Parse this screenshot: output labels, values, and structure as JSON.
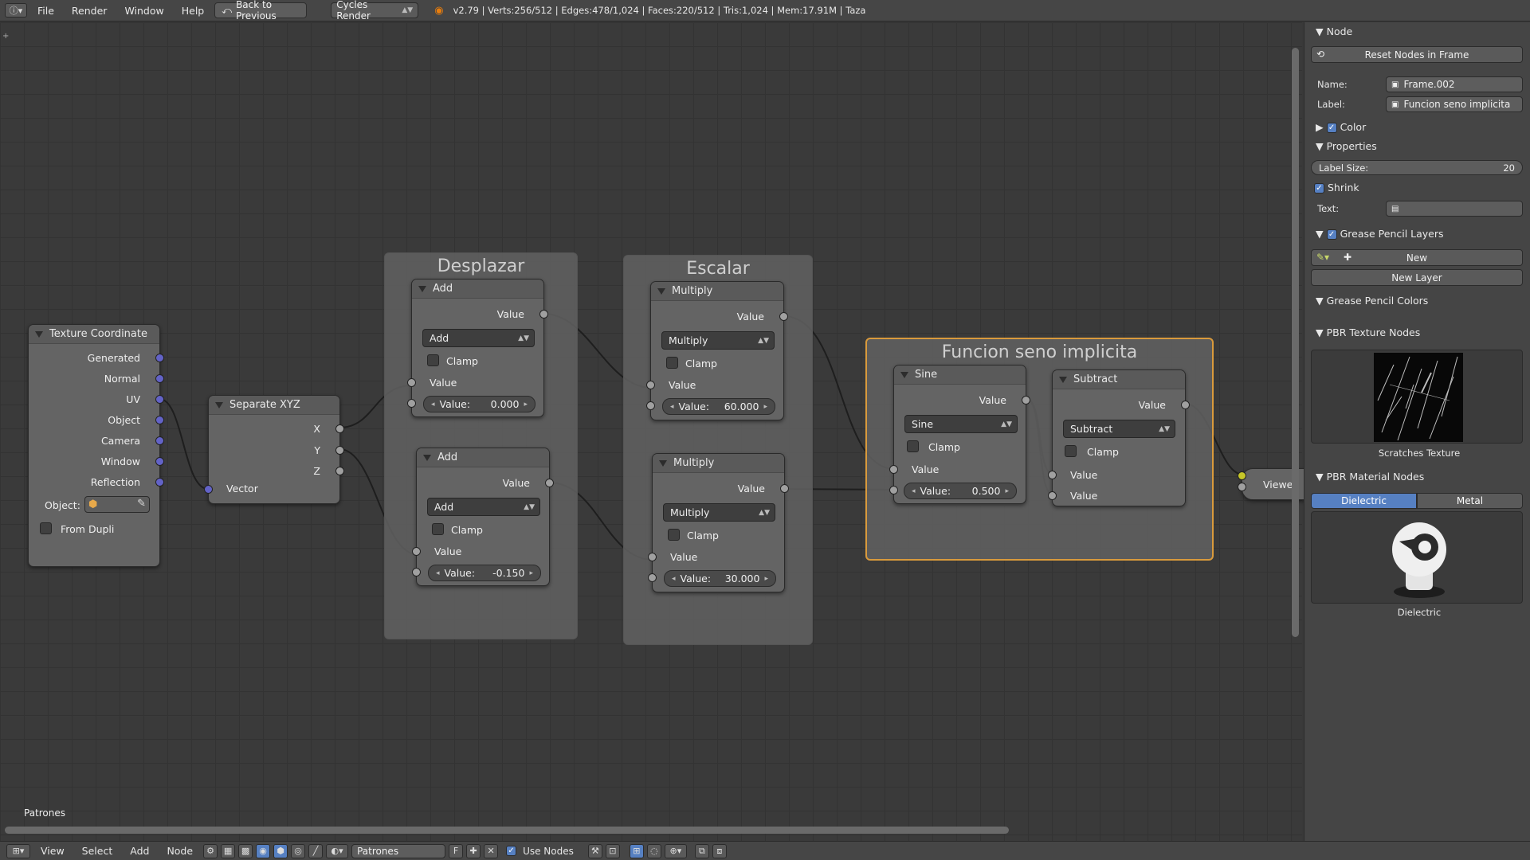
{
  "topbar": {
    "info_icon": "info-icon",
    "menus": [
      "File",
      "Render",
      "Window",
      "Help"
    ],
    "back_button": "Back to Previous",
    "engine": "Cycles Render",
    "stats": "v2.79 | Verts:256/512 | Edges:478/1,024 | Faces:220/512 | Tris:1,024 | Mem:17.91M | Taza"
  },
  "editor": {
    "scene_label": "Patrones",
    "frames": {
      "desplazar": "Desplazar",
      "escalar": "Escalar",
      "funcion": "Funcion seno implicita"
    },
    "tex_coord": {
      "title": "Texture Coordinate",
      "outputs": [
        "Generated",
        "Normal",
        "UV",
        "Object",
        "Camera",
        "Window",
        "Reflection"
      ],
      "object_label": "Object:",
      "from_dupli": "From Dupli"
    },
    "separate": {
      "title": "Separate XYZ",
      "outputs": [
        "X",
        "Y",
        "Z"
      ],
      "input": "Vector"
    },
    "add1": {
      "title": "Add",
      "out": "Value",
      "op": "Add",
      "clamp": "Clamp",
      "in": "Value",
      "field_label": "Value:",
      "field_value": "0.000"
    },
    "add2": {
      "title": "Add",
      "out": "Value",
      "op": "Add",
      "clamp": "Clamp",
      "in": "Value",
      "field_label": "Value:",
      "field_value": "-0.150"
    },
    "mul1": {
      "title": "Multiply",
      "out": "Value",
      "op": "Multiply",
      "clamp": "Clamp",
      "in": "Value",
      "field_label": "Value:",
      "field_value": "60.000"
    },
    "mul2": {
      "title": "Multiply",
      "out": "Value",
      "op": "Multiply",
      "clamp": "Clamp",
      "in": "Value",
      "field_label": "Value:",
      "field_value": "30.000"
    },
    "sine": {
      "title": "Sine",
      "out": "Value",
      "op": "Sine",
      "clamp": "Clamp",
      "in": "Value",
      "field_label": "Value:",
      "field_value": "0.500"
    },
    "subtract": {
      "title": "Subtract",
      "out": "Value",
      "op": "Subtract",
      "clamp": "Clamp",
      "in1": "Value",
      "in2": "Value"
    },
    "viewer": {
      "title": "Viewer"
    }
  },
  "panel": {
    "node_header": "Node",
    "reset_button": "Reset Nodes in Frame",
    "name_label": "Name:",
    "name_value": "Frame.002",
    "label_label": "Label:",
    "label_value": "Funcion seno implicita",
    "color_header": "Color",
    "properties_header": "Properties",
    "label_size_label": "Label Size:",
    "label_size_value": "20",
    "shrink": "Shrink",
    "text_label": "Text:",
    "gp_layers_header": "Grease Pencil Layers",
    "gp_new": "New",
    "new_layer": "New Layer",
    "gp_colors_header": "Grease Pencil Colors",
    "pbr_texture_header": "PBR Texture Nodes",
    "texture_caption": "Scratches Texture",
    "pbr_material_header": "PBR Material Nodes",
    "tab_dielectric": "Dielectric",
    "tab_metal": "Metal",
    "material_caption": "Dielectric"
  },
  "bottombar": {
    "menus": [
      "View",
      "Select",
      "Add",
      "Node"
    ],
    "material_name": "Patrones",
    "fake_user": "F",
    "use_nodes": "Use Nodes"
  },
  "colors": {
    "accent_blue": "#5680c2",
    "frame_selected": "#d99a3c",
    "vector_socket": "#6363c7",
    "shader_socket": "#c7c729"
  }
}
